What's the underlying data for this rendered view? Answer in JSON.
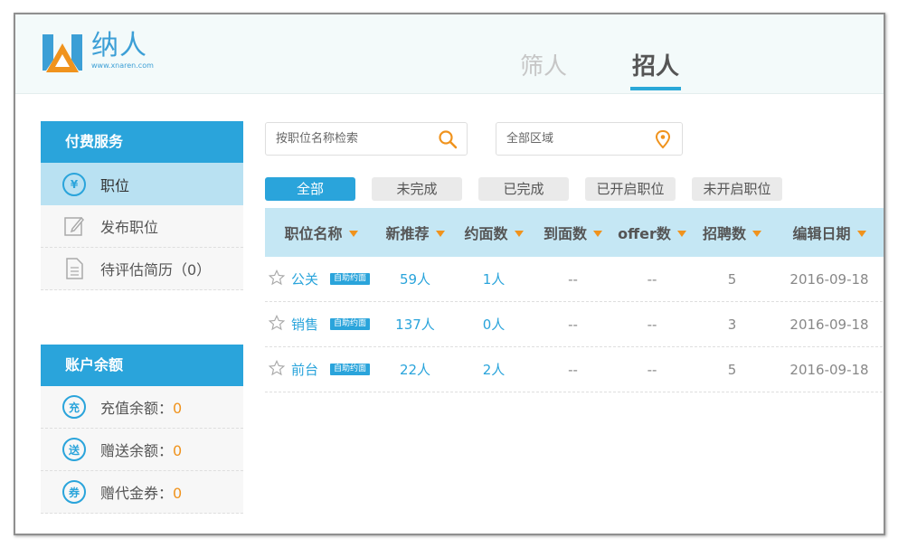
{
  "app": {
    "name": "纳人",
    "url": "www.xnaren.com"
  },
  "top_tabs": [
    {
      "label": "筛人",
      "active": false
    },
    {
      "label": "招人",
      "active": true
    }
  ],
  "sidebar": {
    "paid_services": {
      "title": "付费服务",
      "items": [
        {
          "label": "职位",
          "icon": "yen-icon",
          "active": true
        },
        {
          "label": "发布职位",
          "icon": "edit-icon",
          "active": false
        },
        {
          "label": "待评估简历（0）",
          "icon": "document-icon",
          "active": false
        }
      ]
    },
    "balance": {
      "title": "账户余额",
      "items": [
        {
          "icon_text": "充",
          "label": "充值余额：",
          "amount": "0"
        },
        {
          "icon_text": "送",
          "label": "赠送余额：",
          "amount": "0"
        },
        {
          "icon_text": "券",
          "label": "赠代金券：",
          "amount": "0"
        }
      ]
    }
  },
  "search": {
    "placeholder": "按职位名称检索",
    "icon": "search-icon"
  },
  "area": {
    "value": "全部区域",
    "icon": "location-pin-icon"
  },
  "filters": [
    {
      "label": "全部",
      "active": true
    },
    {
      "label": "未完成",
      "active": false
    },
    {
      "label": "已完成",
      "active": false
    },
    {
      "label": "已开启职位",
      "active": false
    },
    {
      "label": "未开启职位",
      "active": false
    }
  ],
  "table": {
    "columns": [
      "职位名称",
      "新推荐",
      "约面数",
      "到面数",
      "offer数",
      "招聘数",
      "编辑日期"
    ],
    "rows": [
      {
        "name": "公关",
        "badge": "自助约面",
        "recommended": "59人",
        "interviews": "1人",
        "arrived": "--",
        "offers": "--",
        "hires": "5",
        "date": "2016-09-18"
      },
      {
        "name": "销售",
        "badge": "自助约面",
        "recommended": "137人",
        "interviews": "0人",
        "arrived": "--",
        "offers": "--",
        "hires": "3",
        "date": "2016-09-18"
      },
      {
        "name": "前台",
        "badge": "自助约面",
        "recommended": "22人",
        "interviews": "2人",
        "arrived": "--",
        "offers": "--",
        "hires": "5",
        "date": "2016-09-18"
      }
    ]
  },
  "colors": {
    "accent": "#2aa4db",
    "highlight": "#b9e1f2",
    "table_header": "#c5e7f4",
    "orange": "#f0931d"
  }
}
